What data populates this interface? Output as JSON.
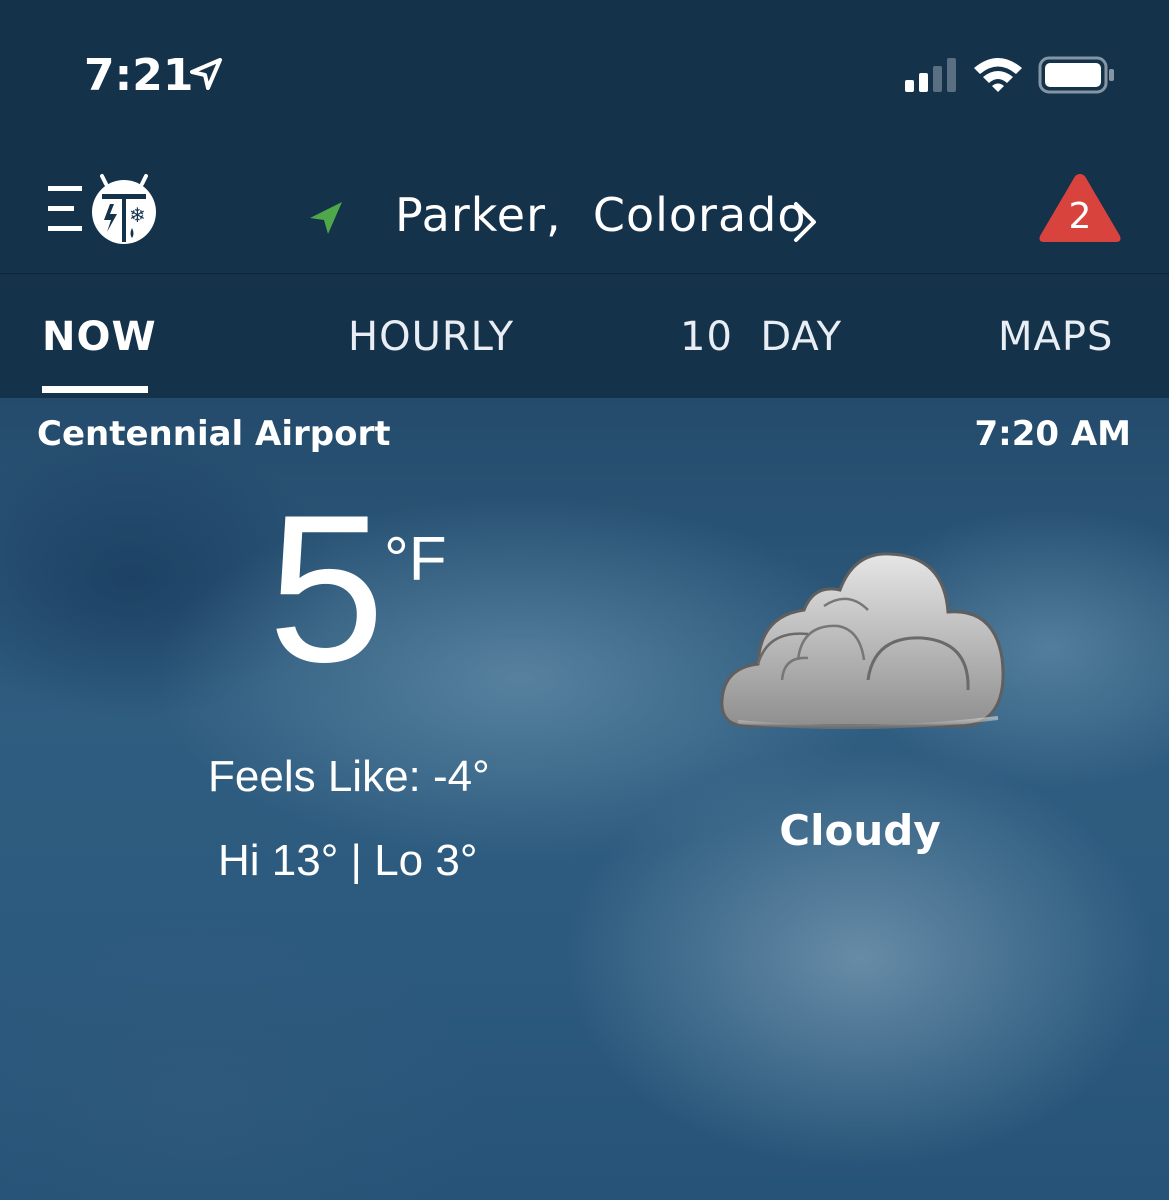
{
  "status_bar": {
    "time": "7:21"
  },
  "header": {
    "location": "Parker,  Colorado",
    "alert_count": "2",
    "alert_color": "#d9433e",
    "pin_color": "#4ea84a"
  },
  "tabs": [
    {
      "label": "NOW",
      "active": true
    },
    {
      "label": "HOURLY",
      "active": false
    },
    {
      "label": "10  DAY",
      "active": false
    },
    {
      "label": "MAPS",
      "active": false
    }
  ],
  "current": {
    "station": "Centennial Airport",
    "observed_time": "7:20 AM",
    "temperature": "5",
    "unit": "°F",
    "feels_like": "Feels Like: -4°",
    "hi_lo": "Hi 13° | Lo 3°",
    "condition": "Cloudy",
    "condition_icon": "cloud-icon"
  },
  "icons": {
    "menu": "menu-icon",
    "logo": "weatherbug-logo-icon",
    "location_pin": "location-arrow-icon",
    "chevron": "chevron-right-icon",
    "alert": "alert-triangle-icon",
    "signal": "cellular-signal-icon",
    "wifi": "wifi-icon",
    "battery": "battery-icon"
  }
}
